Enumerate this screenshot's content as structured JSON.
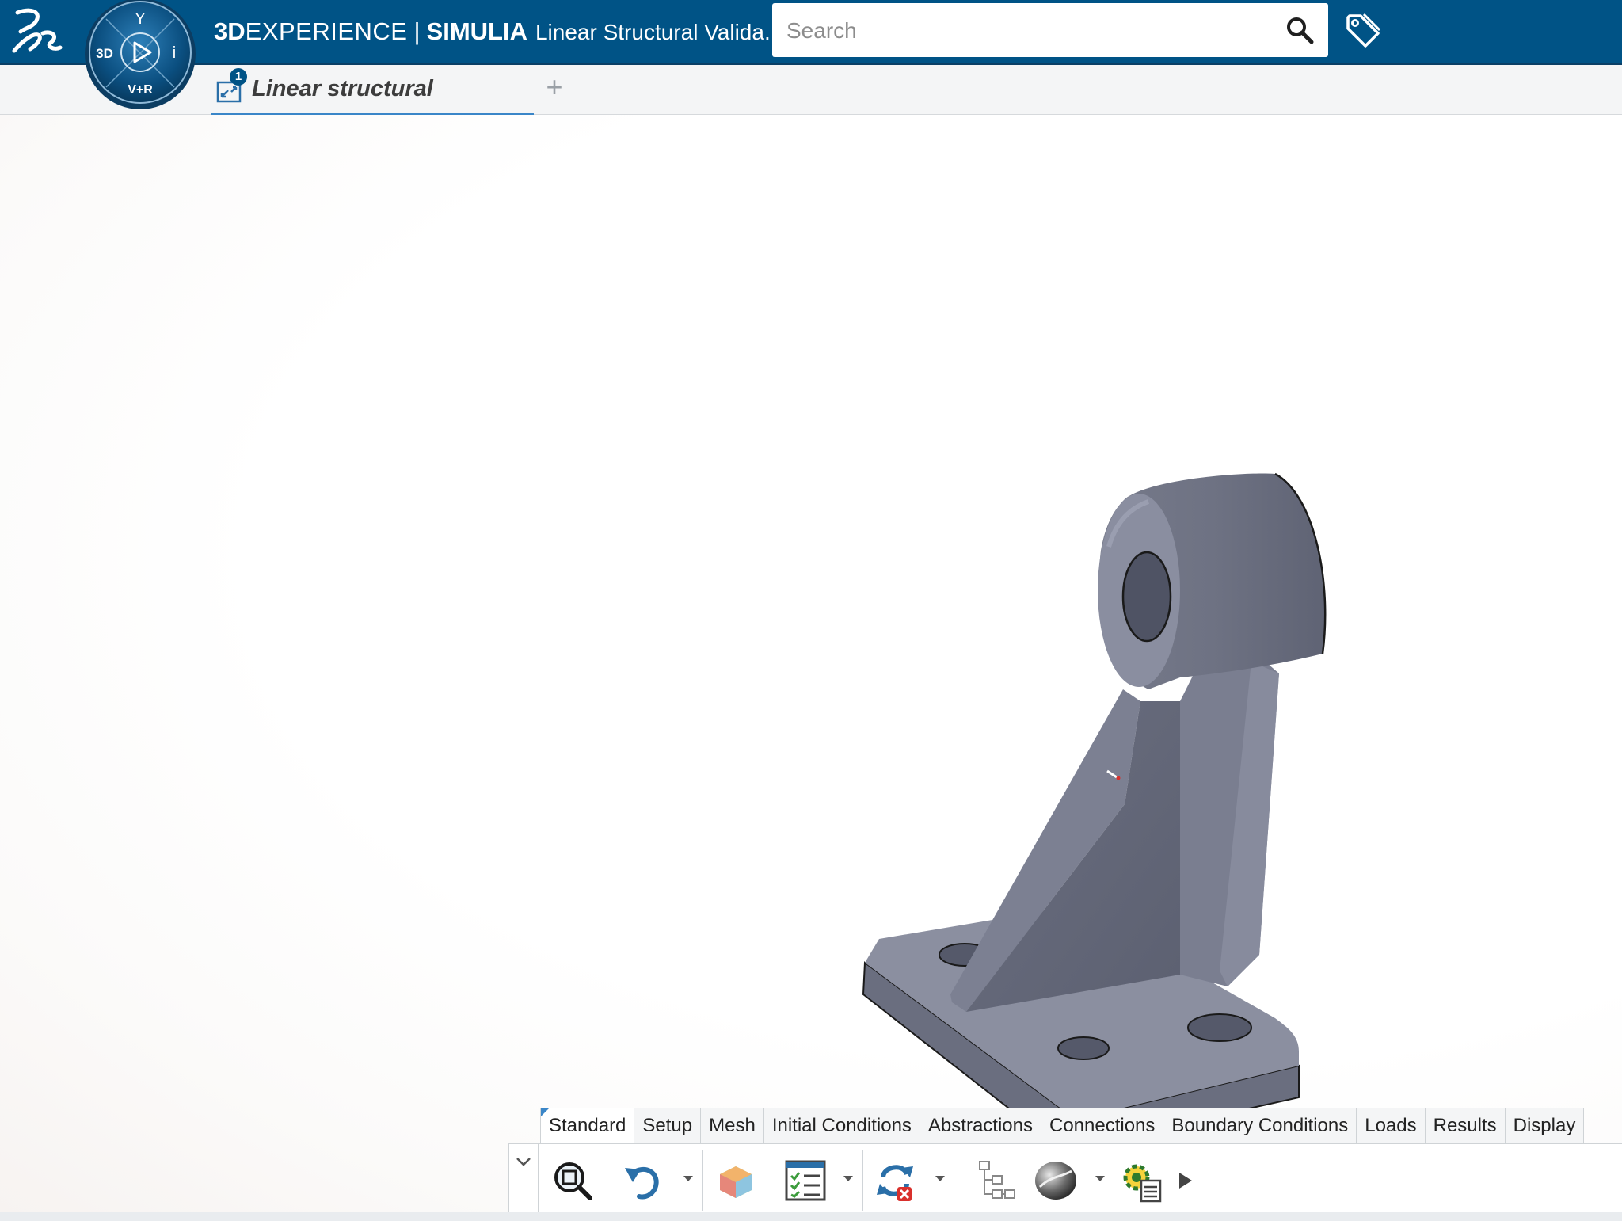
{
  "header": {
    "brand_bold": "3D",
    "brand_light": "EXPERIENCE",
    "separator": "|",
    "app_name": "SIMULIA",
    "document_title": "Linear Structural Valida...",
    "search_placeholder": "Search",
    "colors": {
      "bar": "#005386",
      "accent": "#3a86c8"
    }
  },
  "compass": {
    "top": "Y",
    "left": "3D",
    "right": "i",
    "bottom": "V+R"
  },
  "tabs": [
    {
      "label": "Linear structural",
      "badge": "1"
    }
  ],
  "tab_add": "+",
  "ribbon": {
    "tabs": [
      "Standard",
      "Setup",
      "Mesh",
      "Initial Conditions",
      "Abstractions",
      "Connections",
      "Boundary Conditions",
      "Loads",
      "Results",
      "Display"
    ],
    "active_tab": "Standard",
    "tools": [
      "zoom-fit-icon",
      "undo-icon",
      "part-color-icon",
      "checklist-icon",
      "update-error-icon",
      "tree-icon",
      "render-style-icon",
      "settings-list-icon",
      "more-arrow-icon"
    ]
  }
}
